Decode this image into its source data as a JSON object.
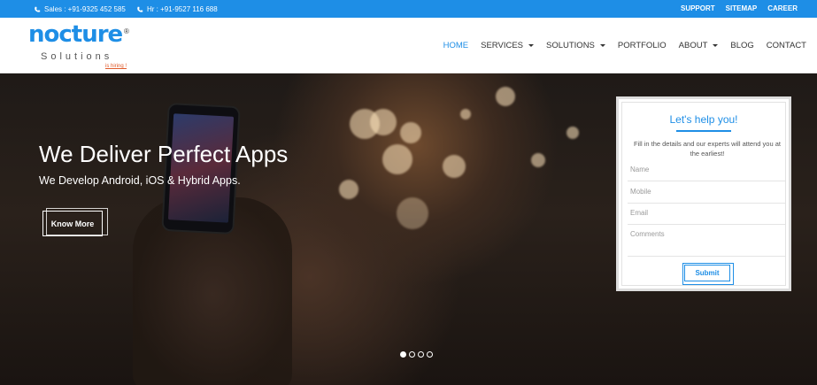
{
  "topbar": {
    "sales": "Sales : +91-9325 452 585",
    "hr": "Hr : +91-9527 116 688",
    "links": [
      "SUPPORT",
      "SITEMAP",
      "CAREER"
    ]
  },
  "brand": {
    "name": "nocture",
    "registered": "®",
    "subtitle": "Solutions",
    "hiring": "is hiring !"
  },
  "nav": {
    "items": [
      {
        "label": "HOME",
        "active": true,
        "dropdown": false
      },
      {
        "label": "SERVICES",
        "active": false,
        "dropdown": true
      },
      {
        "label": "SOLUTIONS",
        "active": false,
        "dropdown": true
      },
      {
        "label": "PORTFOLIO",
        "active": false,
        "dropdown": false
      },
      {
        "label": "ABOUT",
        "active": false,
        "dropdown": true
      },
      {
        "label": "BLOG",
        "active": false,
        "dropdown": false
      },
      {
        "label": "CONTACT",
        "active": false,
        "dropdown": false
      }
    ]
  },
  "hero": {
    "title": "We Deliver Perfect Apps",
    "subtitle": "We Develop Android, iOS & Hybrid Apps.",
    "cta": "Know More",
    "slides": 4,
    "active_slide": 1
  },
  "form": {
    "title": "Let's help you!",
    "description": "Fill in the details and our experts will attend you at the earliest!",
    "fields": {
      "name": "Name",
      "mobile": "Mobile",
      "email": "Email",
      "comments": "Comments"
    },
    "submit": "Submit"
  },
  "colors": {
    "accent": "#1e8ee6",
    "hiring": "#e05a2a"
  }
}
